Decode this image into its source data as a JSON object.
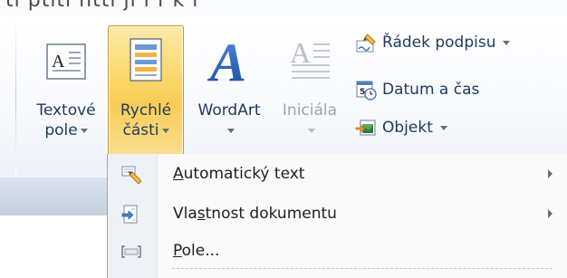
{
  "top_cut_text": "ti ptiti htti jí i f k i",
  "ribbon": {
    "buttons": [
      {
        "id": "textbox",
        "line1": "Textové",
        "line2": "pole",
        "has_arrow": true,
        "disabled": false,
        "icon": "text-box-icon"
      },
      {
        "id": "quickparts",
        "line1": "Rychlé",
        "line2": "části",
        "has_arrow": true,
        "disabled": false,
        "icon": "quick-parts-icon",
        "active": true
      },
      {
        "id": "wordart",
        "line1": "WordArt",
        "line2": "",
        "has_arrow": true,
        "disabled": false,
        "icon": "wordart-icon"
      },
      {
        "id": "dropcap",
        "line1": "Iniciála",
        "line2": "",
        "has_arrow": true,
        "disabled": true,
        "icon": "drop-cap-icon"
      }
    ],
    "small_buttons": [
      {
        "id": "signature",
        "label": "Řádek podpisu",
        "has_arrow": true,
        "icon": "signature-line-icon"
      },
      {
        "id": "datetime",
        "label": "Datum a čas",
        "has_arrow": false,
        "icon": "date-time-icon"
      },
      {
        "id": "object",
        "label": "Objekt",
        "has_arrow": true,
        "icon": "object-icon"
      }
    ]
  },
  "menu": {
    "items": [
      {
        "pre": "",
        "accel": "A",
        "post": "utomatický text",
        "has_submenu": true,
        "icon": "auto-text-icon"
      },
      {
        "pre": "Vla",
        "accel": "s",
        "post": "tnost dokumentu",
        "has_submenu": true,
        "icon": "document-property-icon"
      },
      {
        "pre": "",
        "accel": "P",
        "post": "ole...",
        "has_submenu": false,
        "icon": "field-icon"
      }
    ]
  },
  "colors": {
    "accent_active": "#fbd96e",
    "label_text": "#1e395b",
    "disabled_text": "#9aa3ad",
    "wordart_blue": "#2b63b8"
  }
}
